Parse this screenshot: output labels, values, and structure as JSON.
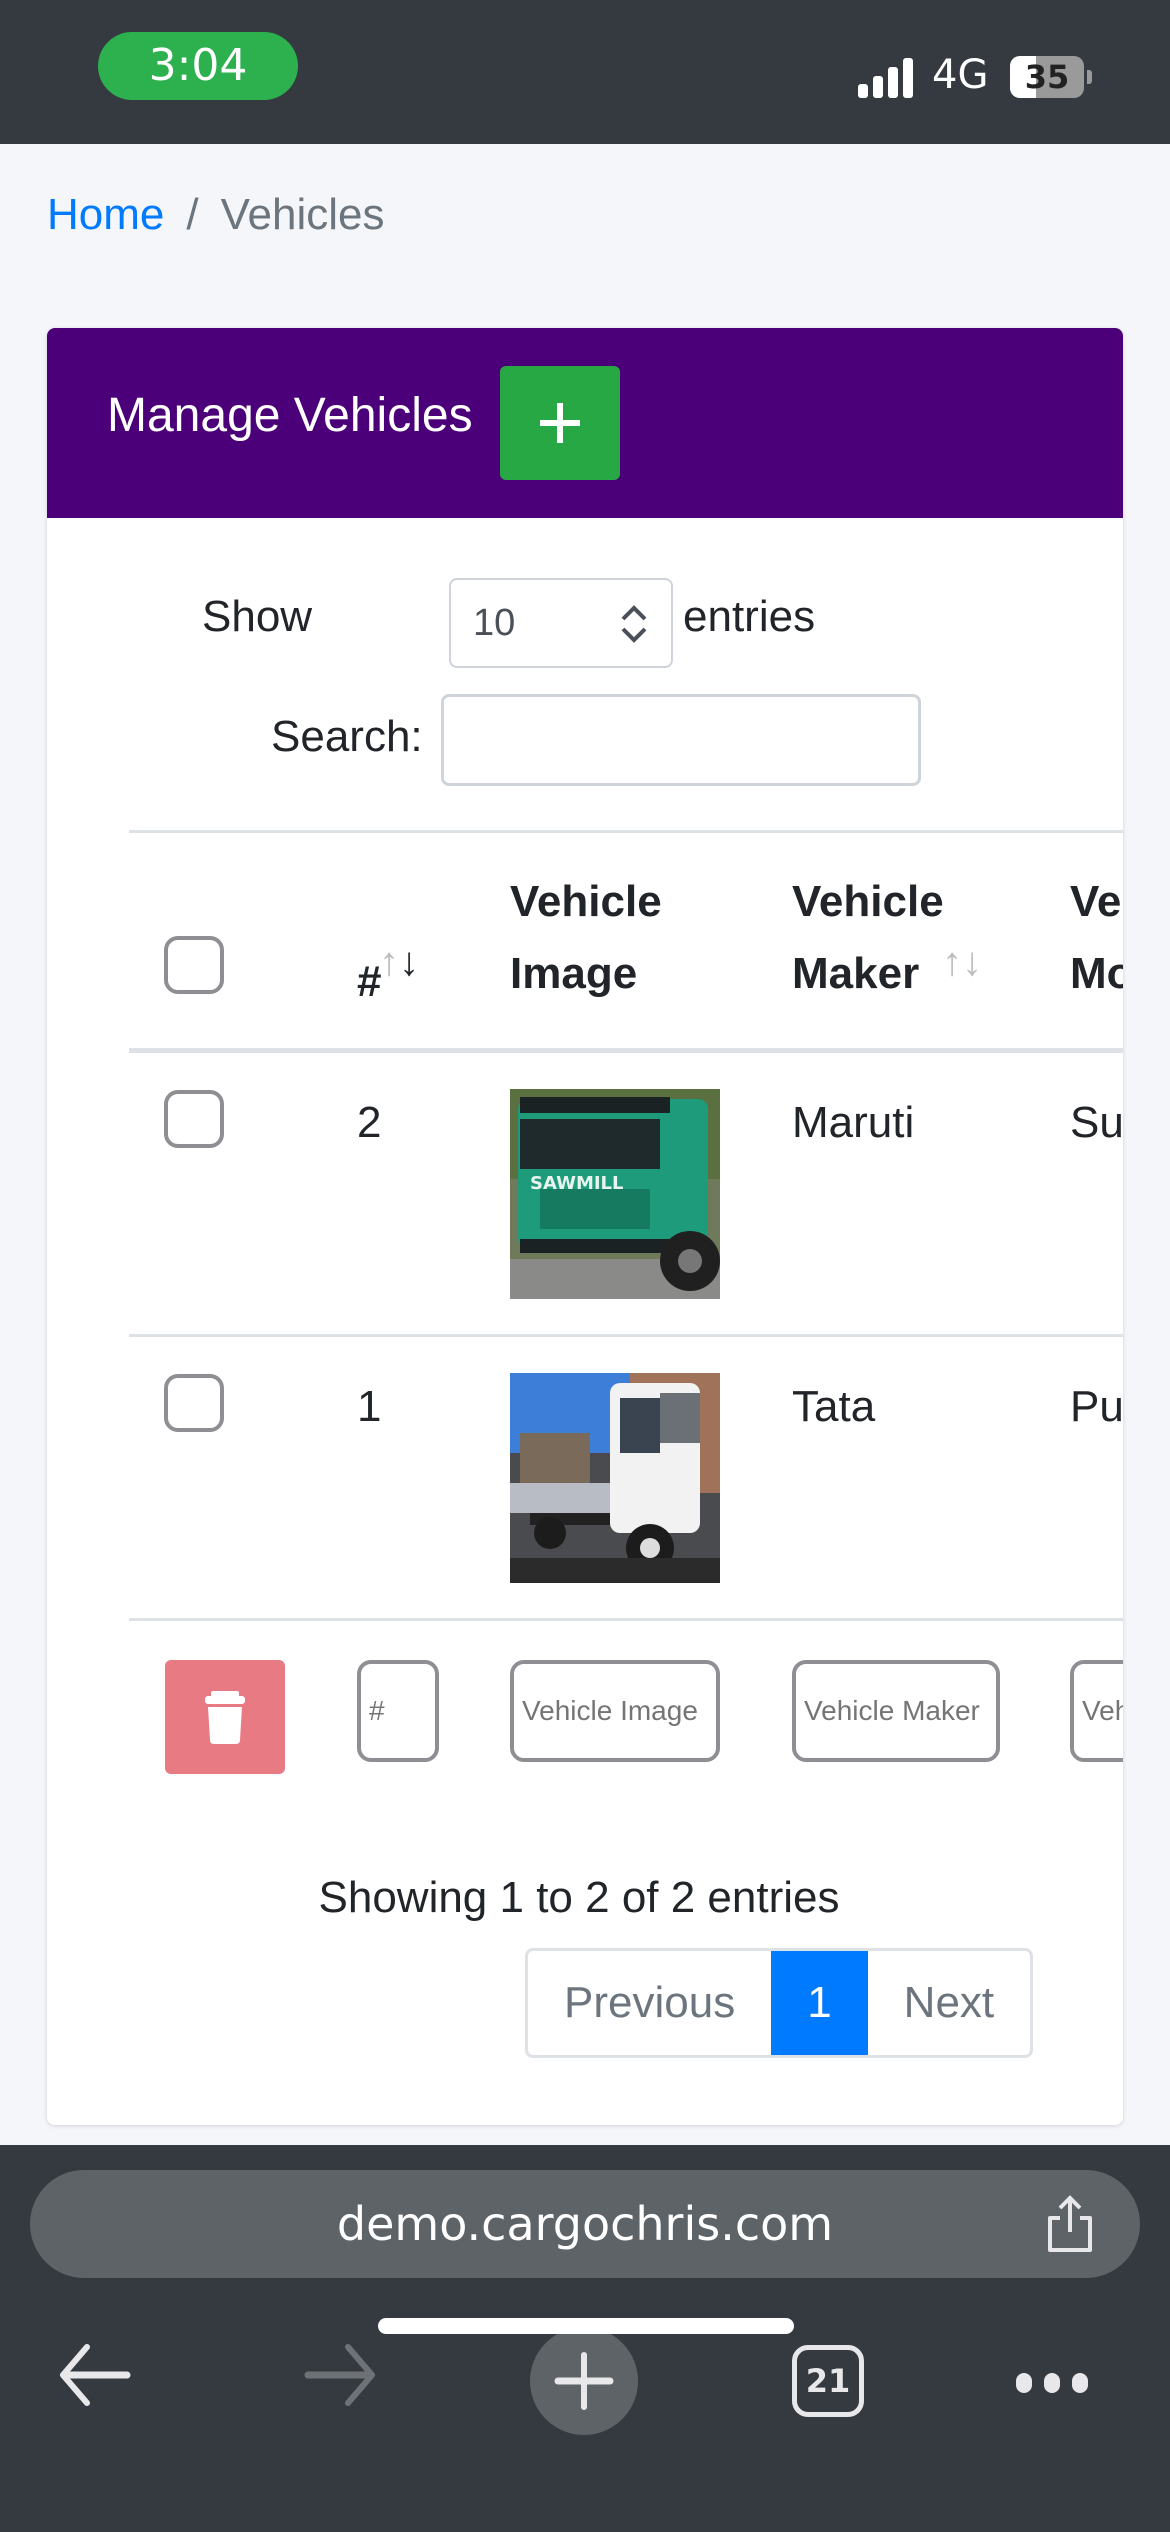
{
  "status_bar": {
    "time": "3:04",
    "network": "4G",
    "battery_level": "35",
    "battery_percent": 35,
    "colors": {
      "time_pill": "#2db14f",
      "background": "#343a40"
    }
  },
  "breadcrumb": {
    "home": "Home",
    "separator": "/",
    "current": "Vehicles"
  },
  "card": {
    "title": "Manage Vehicles",
    "add_button_icon": "plus-icon",
    "colors": {
      "header": "#4b0079",
      "add_button": "#28a745"
    }
  },
  "controls": {
    "show_label": "Show",
    "page_size": "10",
    "entries_label": "entries",
    "search_label": "Search:",
    "search_value": "",
    "search_placeholder": ""
  },
  "table": {
    "columns": [
      {
        "label": "",
        "type": "checkbox"
      },
      {
        "label": "#",
        "sort": "desc"
      },
      {
        "label_line1": "Vehicle",
        "label_line2": "Image"
      },
      {
        "label_line1": "Vehicle",
        "label_line2": "Maker",
        "sort": "none"
      },
      {
        "label_line1": "Ve",
        "label_line2": "Mo"
      }
    ],
    "rows": [
      {
        "id": "2",
        "image": "green-sawmill-truck",
        "image_text": "SAWMILL",
        "maker": "Maruti",
        "model_partial": "Su"
      },
      {
        "id": "1",
        "image": "white-chassis-truck",
        "maker": "Tata",
        "model_partial": "Pu"
      }
    ],
    "filters": {
      "delete_icon": "trash-icon",
      "id_placeholder": "#",
      "image_placeholder": "Vehicle Image",
      "maker_placeholder": "Vehicle Maker",
      "model_placeholder": "Vehicle Model"
    }
  },
  "footer": {
    "showing": "Showing 1 to 2 of 2 entries",
    "pagination": {
      "previous": "Previous",
      "current": "1",
      "next": "Next"
    },
    "colors": {
      "active_page": "#007bff",
      "delete_button": "#e87a84"
    }
  },
  "browser": {
    "url": "demo.cargochris.com",
    "tab_count": "21",
    "icons": [
      "back-arrow-icon",
      "forward-arrow-icon",
      "new-tab-plus-icon",
      "tabs-icon",
      "more-icon",
      "share-icon"
    ]
  }
}
